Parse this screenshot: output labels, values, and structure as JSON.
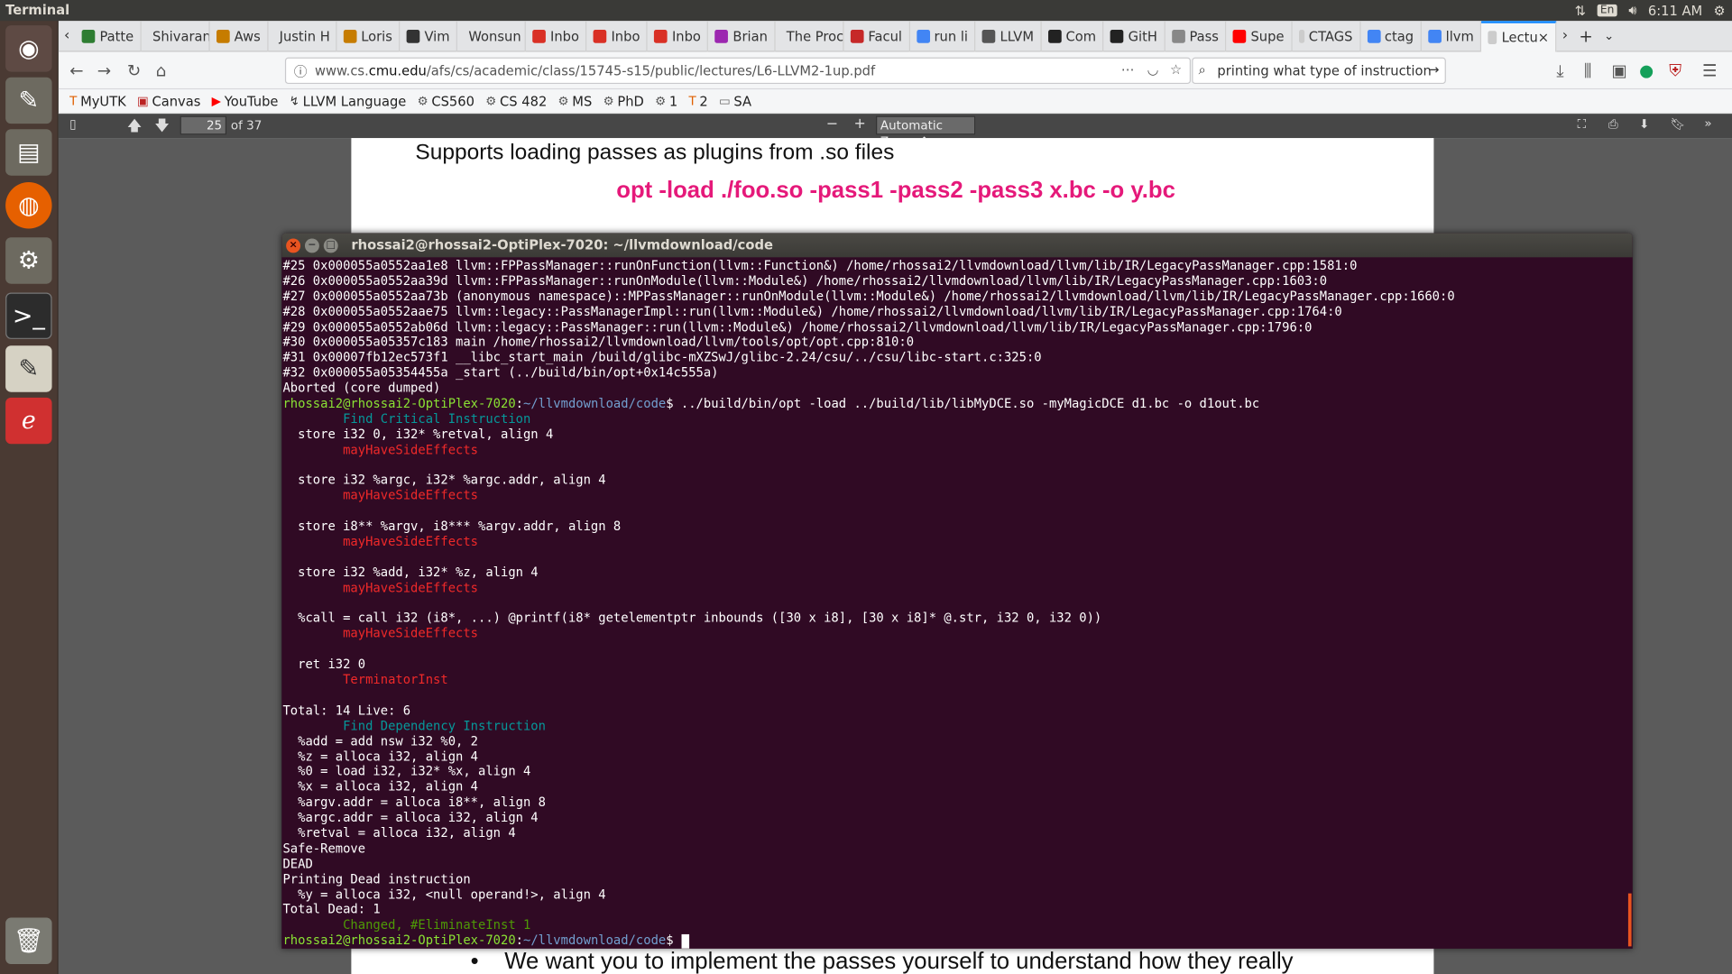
{
  "topbar": {
    "app": "Terminal",
    "lang": "En",
    "time": "6:11 AM"
  },
  "tabs": [
    {
      "label": "Patte",
      "color": "#2e7d32"
    },
    {
      "label": "Shivaran",
      "color": "#cccccc"
    },
    {
      "label": "Aws",
      "color": "#c67c00"
    },
    {
      "label": "Justin H",
      "color": "#cccccc"
    },
    {
      "label": "Loris",
      "color": "#c67c00"
    },
    {
      "label": "Vim",
      "color": "#333333"
    },
    {
      "label": "Wonsun",
      "color": "#cccccc"
    },
    {
      "label": "Inbo",
      "color": "#d93025"
    },
    {
      "label": "Inbo",
      "color": "#d93025"
    },
    {
      "label": "Inbo",
      "color": "#d93025"
    },
    {
      "label": "Brian",
      "color": "#9c27b0"
    },
    {
      "label": "The Proc",
      "color": "#cccccc"
    },
    {
      "label": "Facul",
      "color": "#c62828"
    },
    {
      "label": "run li",
      "color": "#4285f4"
    },
    {
      "label": "LLVM",
      "color": "#555555"
    },
    {
      "label": "Com",
      "color": "#222222"
    },
    {
      "label": "GitH",
      "color": "#222222"
    },
    {
      "label": "Pass",
      "color": "#888888"
    },
    {
      "label": "Supe",
      "color": "#ff0000"
    },
    {
      "label": "CTAGS",
      "color": "#cccccc"
    },
    {
      "label": "ctag",
      "color": "#4285f4"
    },
    {
      "label": "llvm",
      "color": "#4285f4"
    },
    {
      "label": "Lectu",
      "color": "#cccccc",
      "active": true
    }
  ],
  "url": {
    "prefix": "www.cs.",
    "domain": "cmu.edu",
    "path": "/afs/cs/academic/class/15745-s15/public/lectures/L6-LLVM2-1up.pdf"
  },
  "search": {
    "value": "printing what type of instruction"
  },
  "bookmarks": [
    "MyUTK",
    "Canvas",
    "YouTube",
    "LLVM Language",
    "CS560",
    "CS 482",
    "MS",
    "PhD",
    "1",
    "2",
    "SA"
  ],
  "pdf": {
    "page": "25",
    "of": "of 37",
    "zoom": "Automatic Zoom"
  },
  "slide": {
    "heading": "Supports loading passes as plugins from .so files",
    "command": "opt -load ./foo.so -pass1 -pass2 -pass3 x.bc -o y.bc",
    "bullet": "We want you to implement the passes yourself to understand how they really"
  },
  "terminal": {
    "title": "rhossai2@rhossai2-OptiPlex-7020: ~/llvmdownload/code",
    "prompt_user": "rhossai2@rhossai2-OptiPlex-7020",
    "prompt_path": "~/llvmdownload/code",
    "command": "../build/bin/opt -load ../build/lib/libMyDCE.so -myMagicDCE d1.bc -o d1out.bc",
    "pre": [
      "#25 0x000055a0552aa1e8 llvm::FPPassManager::runOnFunction(llvm::Function&) /home/rhossai2/llvmdownload/llvm/lib/IR/LegacyPassManager.cpp:1581:0",
      "#26 0x000055a0552aa39d llvm::FPPassManager::runOnModule(llvm::Module&) /home/rhossai2/llvmdownload/llvm/lib/IR/LegacyPassManager.cpp:1603:0",
      "#27 0x000055a0552aa73b (anonymous namespace)::MPPassManager::runOnModule(llvm::Module&) /home/rhossai2/llvmdownload/llvm/lib/IR/LegacyPassManager.cpp:1660:0",
      "#28 0x000055a0552aae75 llvm::legacy::PassManagerImpl::run(llvm::Module&) /home/rhossai2/llvmdownload/llvm/lib/IR/LegacyPassManager.cpp:1764:0",
      "#29 0x000055a0552ab06d llvm::legacy::PassManager::run(llvm::Module&) /home/rhossai2/llvmdownload/llvm/lib/IR/LegacyPassManager.cpp:1796:0",
      "#30 0x000055a05357c183 main /home/rhossai2/llvmdownload/llvm/tools/opt/opt.cpp:810:0",
      "#31 0x00007fb12ec573f1 __libc_start_main /build/glibc-mXZSwJ/glibc-2.24/csu/../csu/libc-start.c:325:0",
      "#32 0x000055a05354455a _start (../build/bin/opt+0x14c555a)",
      "Aborted (core dumped)"
    ],
    "post": [
      {
        "t": "        Find Critical Instruction",
        "c": "cyan"
      },
      {
        "t": "  store i32 0, i32* %retval, align 4",
        "c": "n"
      },
      {
        "t": "        mayHaveSideEffects",
        "c": "red"
      },
      {
        "t": "",
        "c": "n"
      },
      {
        "t": "  store i32 %argc, i32* %argc.addr, align 4",
        "c": "n"
      },
      {
        "t": "        mayHaveSideEffects",
        "c": "red"
      },
      {
        "t": "",
        "c": "n"
      },
      {
        "t": "  store i8** %argv, i8*** %argv.addr, align 8",
        "c": "n"
      },
      {
        "t": "        mayHaveSideEffects",
        "c": "red"
      },
      {
        "t": "",
        "c": "n"
      },
      {
        "t": "  store i32 %add, i32* %z, align 4",
        "c": "n"
      },
      {
        "t": "        mayHaveSideEffects",
        "c": "red"
      },
      {
        "t": "",
        "c": "n"
      },
      {
        "t": "  %call = call i32 (i8*, ...) @printf(i8* getelementptr inbounds ([30 x i8], [30 x i8]* @.str, i32 0, i32 0))",
        "c": "n"
      },
      {
        "t": "        mayHaveSideEffects",
        "c": "red"
      },
      {
        "t": "",
        "c": "n"
      },
      {
        "t": "  ret i32 0",
        "c": "n"
      },
      {
        "t": "        TerminatorInst",
        "c": "red"
      },
      {
        "t": "",
        "c": "n"
      },
      {
        "t": "Total: 14 Live: 6",
        "c": "n"
      },
      {
        "t": "        Find Dependency Instruction",
        "c": "cyan"
      },
      {
        "t": "  %add = add nsw i32 %0, 2",
        "c": "n"
      },
      {
        "t": "  %z = alloca i32, align 4",
        "c": "n"
      },
      {
        "t": "  %0 = load i32, i32* %x, align 4",
        "c": "n"
      },
      {
        "t": "  %x = alloca i32, align 4",
        "c": "n"
      },
      {
        "t": "  %argv.addr = alloca i8**, align 8",
        "c": "n"
      },
      {
        "t": "  %argc.addr = alloca i32, align 4",
        "c": "n"
      },
      {
        "t": "  %retval = alloca i32, align 4",
        "c": "n"
      },
      {
        "t": "Safe-Remove",
        "c": "n"
      },
      {
        "t": "DEAD",
        "c": "n"
      },
      {
        "t": "Printing Dead instruction",
        "c": "n"
      },
      {
        "t": "  %y = alloca i32, <null operand!>, align 4",
        "c": "n"
      },
      {
        "t": "Total Dead: 1",
        "c": "n"
      },
      {
        "t": "        Changed, #EliminateInst 1",
        "c": "green"
      }
    ]
  }
}
